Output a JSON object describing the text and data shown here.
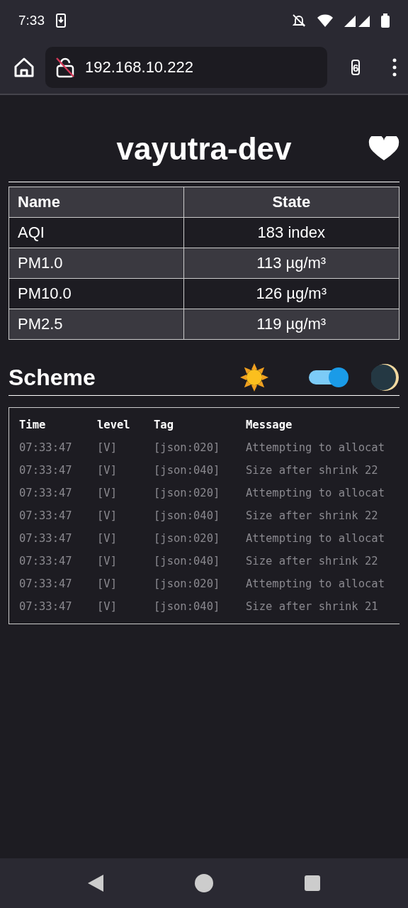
{
  "status_bar": {
    "time": "7:33"
  },
  "browser": {
    "url": "192.168.10.222",
    "tab_count": "6"
  },
  "page": {
    "title": "vayutra-dev",
    "sensors": {
      "columns": [
        "Name",
        "State"
      ],
      "rows": [
        {
          "name": "AQI",
          "state": "183 index"
        },
        {
          "name": "PM1.0",
          "state": "113 µg/m³"
        },
        {
          "name": "PM10.0",
          "state": "126 µg/m³"
        },
        {
          "name": "PM2.5",
          "state": "119 µg/m³"
        }
      ]
    },
    "scheme": {
      "title": "Scheme",
      "dark": true
    },
    "log": {
      "columns": [
        "Time",
        "level",
        "Tag",
        "Message"
      ],
      "rows": [
        {
          "time": "07:33:47",
          "level": "[V]",
          "tag": "[json:020]",
          "message": "Attempting to allocat"
        },
        {
          "time": "07:33:47",
          "level": "[V]",
          "tag": "[json:040]",
          "message": "Size after shrink 22"
        },
        {
          "time": "07:33:47",
          "level": "[V]",
          "tag": "[json:020]",
          "message": "Attempting to allocat"
        },
        {
          "time": "07:33:47",
          "level": "[V]",
          "tag": "[json:040]",
          "message": "Size after shrink 22"
        },
        {
          "time": "07:33:47",
          "level": "[V]",
          "tag": "[json:020]",
          "message": "Attempting to allocat"
        },
        {
          "time": "07:33:47",
          "level": "[V]",
          "tag": "[json:040]",
          "message": "Size after shrink 22"
        },
        {
          "time": "07:33:47",
          "level": "[V]",
          "tag": "[json:020]",
          "message": "Attempting to allocat"
        },
        {
          "time": "07:33:47",
          "level": "[V]",
          "tag": "[json:040]",
          "message": "Size after shrink 21"
        }
      ]
    }
  }
}
